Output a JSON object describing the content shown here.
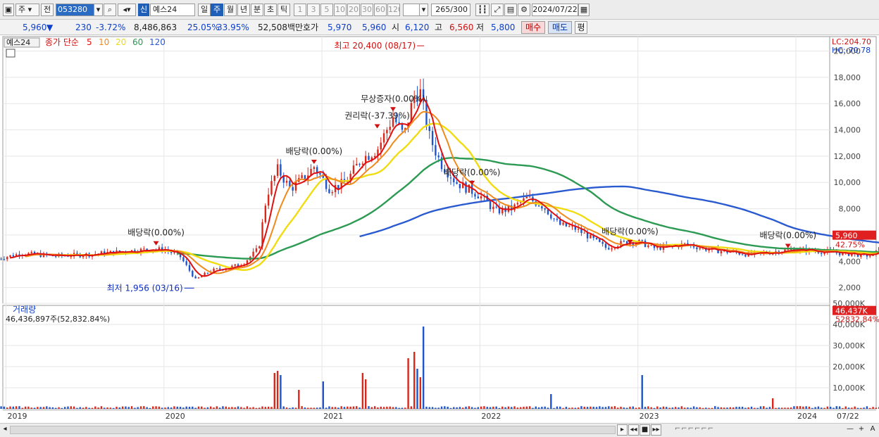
{
  "toolbar": {
    "market": "주",
    "prev": "전",
    "code": "053280",
    "new_badge": "신",
    "stock_name": "예스24",
    "periods": [
      "일",
      "주",
      "월",
      "년",
      "분",
      "초",
      "틱"
    ],
    "selected_period": "주",
    "intervals": [
      "1",
      "3",
      "5",
      "10",
      "20",
      "30",
      "60",
      "120"
    ],
    "count": "265",
    "count_max": "/300",
    "date": "2024/07/22"
  },
  "quote": {
    "price": "5,960",
    "change_arrow": "▼",
    "change": "230",
    "change_pct": "-3.72%",
    "volume": "8,486,863",
    "pct1": "25.05%",
    "pct2": "33.95%",
    "amount": "52,508백만",
    "ask_label": "호가",
    "ask1": "5,970",
    "ask2": "5,960",
    "open_label": "시",
    "open": "6,120",
    "high_label": "고",
    "high": "6,560",
    "low_label": "저",
    "low": "5,800",
    "buy": "매수",
    "sell": "매도",
    "eval": "평"
  },
  "bottom": {
    "buttons": [
      "▸",
      "◂◂",
      "■",
      "▸▸"
    ],
    "zoom": [
      "—",
      "+",
      "A"
    ]
  },
  "colors": {
    "up": "#d8281c",
    "down": "#1f55c8",
    "ma5": "#e01010",
    "ma10": "#f08a1c",
    "ma20": "#f0dc10",
    "ma60": "#2c9a52",
    "ma120": "#2a5ad0"
  },
  "chart_data": {
    "type": "candlestick",
    "title": "예스24",
    "legend": {
      "prefix": "종가 단순",
      "periods": [
        "5",
        "10",
        "20",
        "60",
        "120"
      ]
    },
    "x_ticks": [
      "2019",
      "2020",
      "2021",
      "2022",
      "2023",
      "2024",
      "07/22"
    ],
    "price_ticks": [
      "20,000",
      "18,000",
      "16,000",
      "14,000",
      "12,000",
      "10,000",
      "8,000",
      "6,000",
      "4,000",
      "2,000"
    ],
    "price_ylim": [
      800,
      21100
    ],
    "volume_ticks": [
      "50,000K",
      "40,000K",
      "30,000K",
      "20,000K",
      "10,000K"
    ],
    "volume_ylim": [
      0,
      49000
    ],
    "volume_title": "거래량",
    "volume_info": "46,436,897주(52,832.84%)",
    "top_right_info": [
      "LC:204.70",
      "HC:-70.78"
    ],
    "current_price_label": "5,960",
    "current_pct_label": "42.75%",
    "current_volume_label": "46,437K",
    "current_volume_pct_label": "52832.84%",
    "annotations": [
      {
        "text": "최고 20,400 (08/17)",
        "date": 2021.62,
        "price": 20400,
        "kind": "high"
      },
      {
        "text": "최저 1,956 (03/16)",
        "date": 2020.2,
        "price": 1956,
        "kind": "low"
      },
      {
        "text": "배당락(0.00%)",
        "date": 2019.95,
        "price": 5100,
        "kind": "event"
      },
      {
        "text": "배당락(0.00%)",
        "date": 2020.95,
        "price": 11300,
        "kind": "event"
      },
      {
        "text": "권리락(-37.39%)",
        "date": 2021.35,
        "price": 14000,
        "kind": "event"
      },
      {
        "text": "무상증자(0.00%)",
        "date": 2021.45,
        "price": 15300,
        "kind": "event"
      },
      {
        "text": "배당락(0.00%)",
        "date": 2021.95,
        "price": 9700,
        "kind": "event"
      },
      {
        "text": "배당락(0.00%)",
        "date": 2022.95,
        "price": 5200,
        "kind": "event"
      },
      {
        "text": "배당락(0.00%)",
        "date": 2023.95,
        "price": 4900,
        "kind": "event"
      }
    ],
    "anchors": [
      [
        2018.95,
        4200
      ],
      [
        2019.1,
        4600
      ],
      [
        2019.3,
        4400
      ],
      [
        2019.5,
        4500
      ],
      [
        2019.7,
        4700
      ],
      [
        2019.9,
        4900
      ],
      [
        2020.0,
        4900
      ],
      [
        2020.1,
        4400
      ],
      [
        2020.2,
        2600
      ],
      [
        2020.3,
        3300
      ],
      [
        2020.4,
        3500
      ],
      [
        2020.5,
        3800
      ],
      [
        2020.6,
        5000
      ],
      [
        2020.65,
        9000
      ],
      [
        2020.72,
        11000
      ],
      [
        2020.8,
        9500
      ],
      [
        2020.9,
        10500
      ],
      [
        2020.95,
        11200
      ],
      [
        2021.05,
        9500
      ],
      [
        2021.15,
        10000
      ],
      [
        2021.25,
        11800
      ],
      [
        2021.35,
        12500
      ],
      [
        2021.45,
        15000
      ],
      [
        2021.52,
        13500
      ],
      [
        2021.58,
        16500
      ],
      [
        2021.62,
        17000
      ],
      [
        2021.68,
        13500
      ],
      [
        2021.75,
        11500
      ],
      [
        2021.85,
        10000
      ],
      [
        2022.0,
        9000
      ],
      [
        2022.1,
        7800
      ],
      [
        2022.2,
        8000
      ],
      [
        2022.3,
        8800
      ],
      [
        2022.4,
        8200
      ],
      [
        2022.5,
        6800
      ],
      [
        2022.6,
        6500
      ],
      [
        2022.7,
        5800
      ],
      [
        2022.8,
        5000
      ],
      [
        2022.9,
        5400
      ],
      [
        2023.0,
        5500
      ],
      [
        2023.1,
        5000
      ],
      [
        2023.2,
        5100
      ],
      [
        2023.3,
        5300
      ],
      [
        2023.4,
        5000
      ],
      [
        2023.5,
        4800
      ],
      [
        2023.6,
        4700
      ],
      [
        2023.7,
        4500
      ],
      [
        2023.8,
        4600
      ],
      [
        2023.9,
        4800
      ],
      [
        2024.0,
        4900
      ],
      [
        2024.1,
        4800
      ],
      [
        2024.2,
        4700
      ],
      [
        2024.3,
        4600
      ],
      [
        2024.4,
        4500
      ],
      [
        2024.5,
        4400
      ],
      [
        2024.55,
        5960
      ]
    ],
    "volume_spikes": [
      [
        2020.7,
        17000
      ],
      [
        2020.72,
        18000
      ],
      [
        2020.74,
        16000
      ],
      [
        2020.85,
        9000
      ],
      [
        2021.0,
        13000
      ],
      [
        2021.25,
        17000
      ],
      [
        2021.28,
        14000
      ],
      [
        2021.55,
        24000
      ],
      [
        2021.58,
        27000
      ],
      [
        2021.6,
        19000
      ],
      [
        2021.62,
        15000
      ],
      [
        2021.65,
        39000
      ],
      [
        2022.45,
        7000
      ],
      [
        2023.02,
        16000
      ],
      [
        2023.85,
        5000
      ],
      [
        2024.55,
        46437
      ]
    ]
  }
}
